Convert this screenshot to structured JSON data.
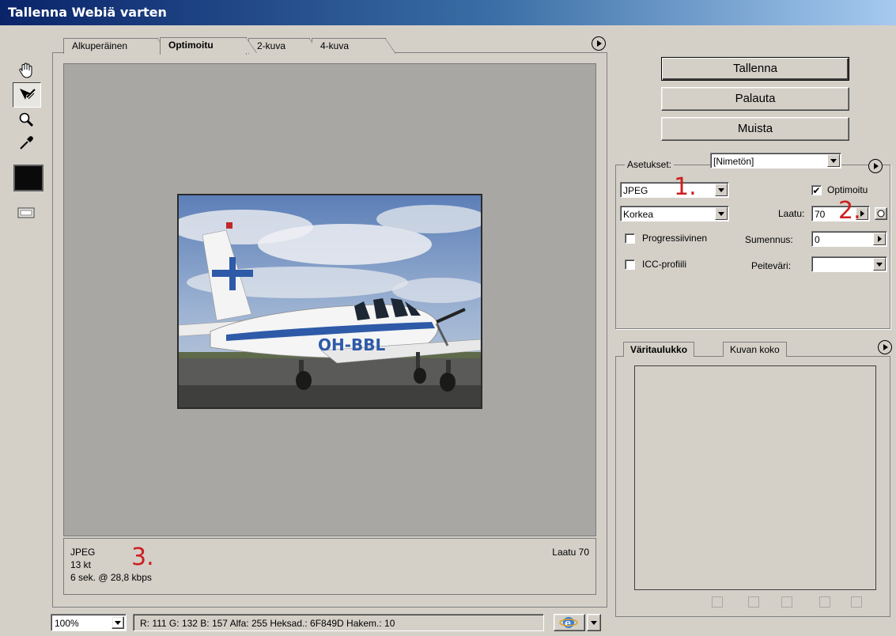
{
  "window": {
    "title": "Tallenna Webiä varten"
  },
  "tabs": [
    {
      "label": "Alkuperäinen",
      "active": false
    },
    {
      "label": "Optimoitu",
      "active": true
    },
    {
      "label": "2-kuva",
      "active": false
    },
    {
      "label": "4-kuva",
      "active": false
    }
  ],
  "tools": [
    {
      "icon": "hand-icon",
      "active": false
    },
    {
      "icon": "slice-select-icon",
      "active": true
    },
    {
      "icon": "zoom-icon",
      "active": false
    },
    {
      "icon": "eyedropper-icon",
      "active": false
    }
  ],
  "preview": {
    "photo_text": "OH-BBL"
  },
  "info": {
    "format": "JPEG",
    "size": "13 kt",
    "time": "6 sek. @ 28,8 kbps",
    "quality": "Laatu 70"
  },
  "annotations": {
    "one": "1.",
    "two": "2.",
    "three": "3."
  },
  "buttons": {
    "save": "Tallenna",
    "reset": "Palauta",
    "remember": "Muista"
  },
  "settings": {
    "label": "Asetukset:",
    "preset": "[Nimetön]",
    "format": "JPEG",
    "quality_preset": "Korkea",
    "optimized_label": "Optimoitu",
    "optimized_checked": "✔",
    "quality_label": "Laatu:",
    "quality_value": "70",
    "progressive_label": "Progressiivinen",
    "blur_label": "Sumennus:",
    "blur_value": "0",
    "icc_label": "ICC-profiili",
    "matte_label": "Peiteväri:",
    "matte_value": ""
  },
  "color_panel": {
    "tabs": [
      {
        "label": "Väritaulukko",
        "active": true
      },
      {
        "label": "Kuvan koko",
        "active": false
      }
    ]
  },
  "statusbar": {
    "zoom": "100%",
    "readout": "R: 111  G: 132  B: 157  Alfa:   255  Heksad.:    6F849D  Hakem.:  10"
  },
  "colors": {
    "title_gradient_start": "#0a246a",
    "title_gradient_end": "#a6caf0",
    "annotation": "#cc1f1f",
    "chrome": "#d4d0c8",
    "preview_bg": "#a8a7a3"
  }
}
